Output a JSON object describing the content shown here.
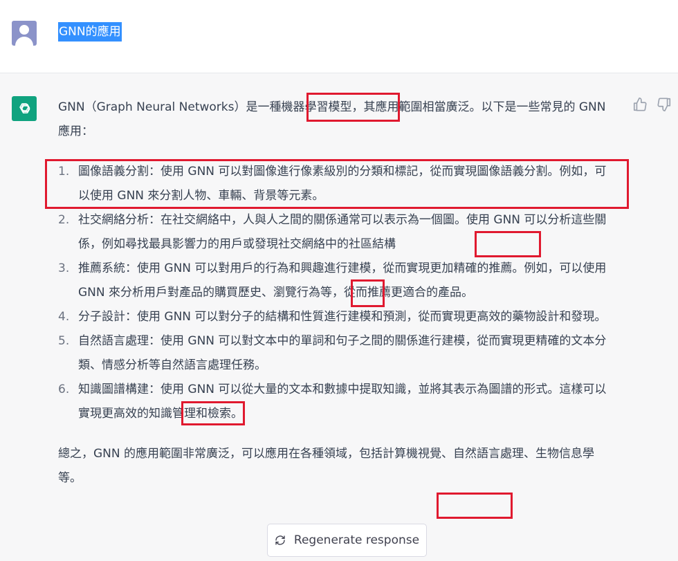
{
  "user": {
    "message": "GNN的應用"
  },
  "assistant": {
    "intro": "GNN（Graph Neural Networks）是一種機器學習模型，其應用範圍相當廣泛。以下是一些常見的 GNN 應用：",
    "items": [
      {
        "num": "1.",
        "text": "圖像語義分割：使用 GNN 可以對圖像進行像素級別的分類和標記，從而實現圖像語義分割。例如，可以使用 GNN 來分割人物、車輛、背景等元素。"
      },
      {
        "num": "2.",
        "text": "社交網絡分析：在社交網絡中，人與人之間的關係通常可以表示為一個圖。使用 GNN 可以分析這些關係，例如尋找最具影響力的用戶或發現社交網絡中的社區結構"
      },
      {
        "num": "3.",
        "text": "推薦系統：使用 GNN 可以對用戶的行為和興趣進行建模，從而實現更加精確的推薦。例如，可以使用 GNN 來分析用戶對產品的購買歷史、瀏覽行為等，從而推薦更適合的產品。"
      },
      {
        "num": "4.",
        "text": "分子設計：使用 GNN 可以對分子的結構和性質進行建模和預測，從而實現更高效的藥物設計和發現。"
      },
      {
        "num": "5.",
        "text": "自然語言處理：使用 GNN 可以對文本中的單詞和句子之間的關係進行建模，從而實現更精確的文本分類、情感分析等自然語言處理任務。"
      },
      {
        "num": "6.",
        "text": "知識圖譜構建：使用 GNN 可以從大量的文本和數據中提取知識，並將其表示為圖譜的形式。這樣可以實現更高效的知識管理和檢索。"
      }
    ],
    "summary": "總之，GNN 的應用範圍非常廣泛，可以應用在各種領域，包括計算機視覺、自然語言處理、生物信息學等。"
  },
  "regenerate_label": "Regenerate response",
  "icons": {
    "user_avatar": "user-avatar-icon",
    "assistant_avatar": "openai-logo-icon",
    "thumbs_up": "thumbs-up-icon",
    "thumbs_down": "thumbs-down-icon",
    "regenerate": "refresh-icon"
  },
  "colors": {
    "selection": "#3390ff",
    "assistant_bg": "#f7f7f8",
    "brand": "#10a37f",
    "annotation": "#e0192f"
  }
}
